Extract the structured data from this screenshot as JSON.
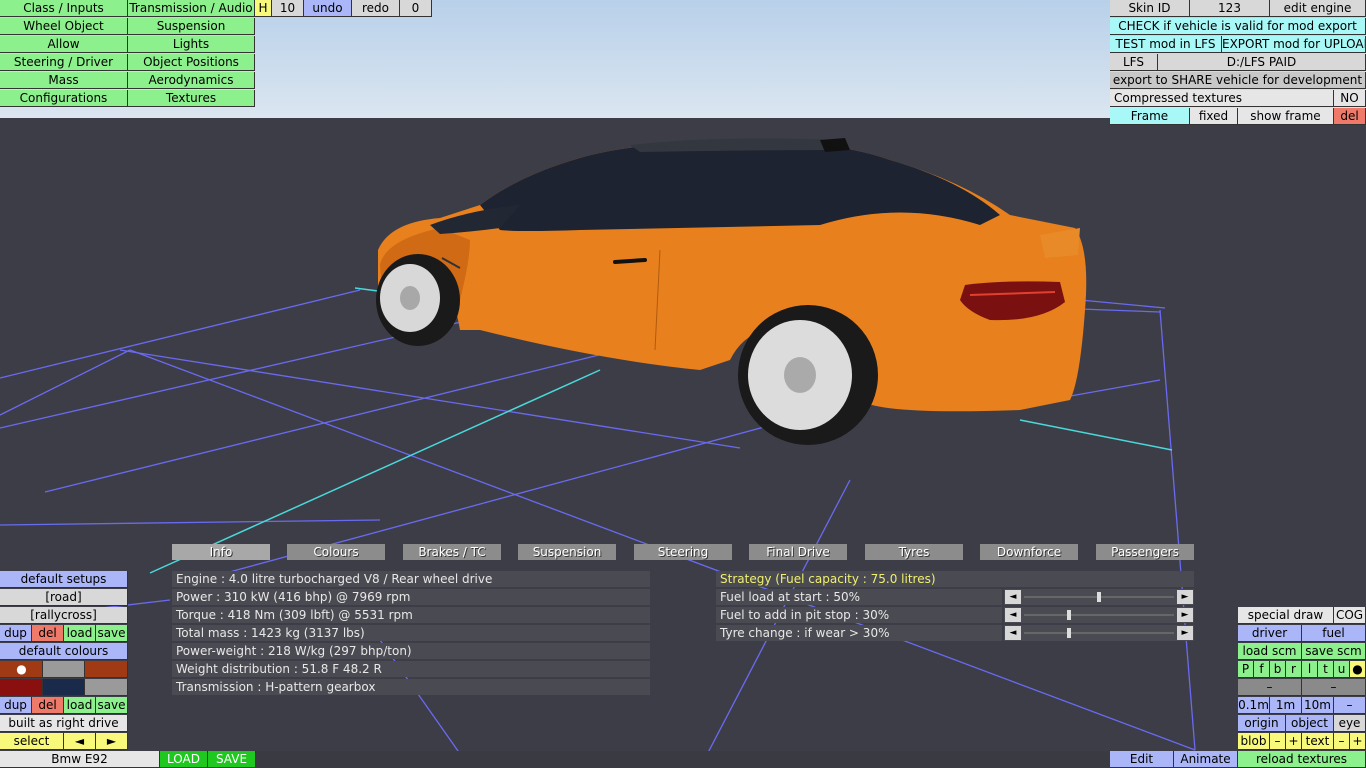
{
  "top_menu": {
    "class_inputs": "Class / Inputs",
    "transmission_audio": "Transmission / Audio",
    "wheel_object": "Wheel Object",
    "suspension": "Suspension",
    "allow": "Allow",
    "lights": "Lights",
    "steering_driver": "Steering / Driver",
    "object_positions": "Object Positions",
    "mass": "Mass",
    "aerodynamics": "Aerodynamics",
    "configurations": "Configurations",
    "textures": "Textures",
    "h": "H",
    "h_value": "10",
    "undo": "undo",
    "redo": "redo",
    "redo_count": "0"
  },
  "right_panel": {
    "skin_id_label": "Skin ID",
    "skin_id_value": "123",
    "edit_engine": "edit engine",
    "check_valid": "CHECK if vehicle is valid for mod export",
    "test_mod": "TEST mod in LFS",
    "export_mod": "EXPORT mod for UPLOAD",
    "lfs_label": "LFS",
    "lfs_path": "D:/LFS PAID",
    "export_share": "export to SHARE vehicle for development",
    "compressed_textures": "Compressed textures",
    "compressed_value": "NO",
    "frame": "Frame",
    "fixed": "fixed",
    "show_frame": "show frame",
    "del": "del"
  },
  "tabs": [
    "Info",
    "Colours",
    "Brakes / TC",
    "Suspension",
    "Steering",
    "Final Drive",
    "Tyres",
    "Downforce",
    "Passengers"
  ],
  "info_lines": [
    "Engine : 4.0 litre turbocharged V8 / Rear wheel drive",
    "Power : 310 kW (416 bhp) @ 7969 rpm",
    "Torque : 418 Nm (309 lbft) @ 5531 rpm",
    "Total mass : 1423 kg (3137 lbs)",
    "Power-weight : 218 W/kg (297 bhp/ton)",
    "Weight distribution : 51.8 F  48.2 R",
    "Transmission : H-pattern gearbox"
  ],
  "strategy": {
    "title": "Strategy (Fuel capacity : 75.0 litres)",
    "rows": [
      {
        "label": "Fuel load at start : 50%",
        "value": 0.5
      },
      {
        "label": "Fuel to add in pit stop : 30%",
        "value": 0.3
      },
      {
        "label": "Tyre change : if wear > 30%",
        "value": 0.3
      }
    ],
    "left_arrow": "◄",
    "right_arrow": "►"
  },
  "left_panel": {
    "default_setups": "default setups",
    "road": "[road]",
    "rallycross": "[rallycross]",
    "dup": "dup",
    "del": "del",
    "load": "load",
    "save": "save",
    "default_colours": "default colours",
    "dot": "●",
    "built_as_right_drive": "built as right drive",
    "select": "select",
    "prev": "◄",
    "next": "►",
    "colours": [
      "#a03a14",
      "#9a9a9a",
      "#a03a14",
      "#8a1010",
      "#1a2a4a",
      "#9a9a9a"
    ]
  },
  "bottom_bar": {
    "vehicle_name": "Bmw E92",
    "load": "LOAD",
    "save": "SAVE",
    "edit": "Edit",
    "animate": "Animate",
    "reload_textures": "reload textures"
  },
  "right_bottom": {
    "special_draw": "special draw",
    "cog": "COG",
    "driver": "driver",
    "fuel": "fuel",
    "load_scm": "load scm",
    "save_scm": "save scm",
    "flags": [
      "P",
      "f",
      "b",
      "r",
      "l",
      "t",
      "u",
      "●"
    ],
    "minus": "–",
    "scale_01": "0.1m",
    "scale_1": "1m",
    "scale_10": "10m",
    "origin": "origin",
    "object": "object",
    "eye": "eye",
    "blob": "blob",
    "plus": "+",
    "text": "text"
  },
  "colors": {
    "car_body": "#e8801e",
    "grid_line": "#6a6af0",
    "axis_line": "#4ad8d8"
  }
}
